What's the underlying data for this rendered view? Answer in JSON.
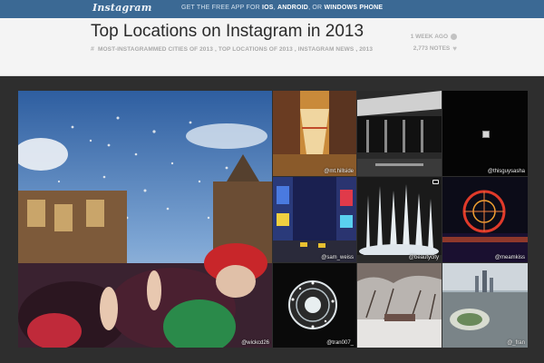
{
  "topbar": {
    "logo": "Instagram",
    "promo_prefix": "GET THE FREE APP FOR",
    "promo_ios": "IOS",
    "promo_comma1": ",",
    "promo_android": "ANDROID",
    "promo_or": ", OR",
    "promo_windows": "WINDOWS PHONE"
  },
  "post": {
    "title": "Top Locations on Instagram in 2013",
    "tags": [
      "MOST-INSTAGRAMMED CITIES OF 2013",
      "TOP LOCATIONS OF 2013",
      "INSTAGRAM NEWS",
      "2013"
    ],
    "age": "1 WEEK AGO",
    "notes": "2,773 NOTES"
  },
  "gallery": {
    "big_caption": "@wickcd26",
    "tiles": [
      {
        "caption": "@mt.hillside"
      },
      {
        "caption": ""
      },
      {
        "caption": "@thisguysasha"
      },
      {
        "caption": "@sam_weiss"
      },
      {
        "caption": "@beautycity"
      },
      {
        "caption": "@meamkiss"
      },
      {
        "caption": "@tran007_"
      },
      {
        "caption": ""
      },
      {
        "caption": "@_fran"
      }
    ]
  },
  "colors": {
    "topbar": "#3b6994",
    "header_bg": "#f4f4f4",
    "page_bg": "#2e2e2e"
  }
}
